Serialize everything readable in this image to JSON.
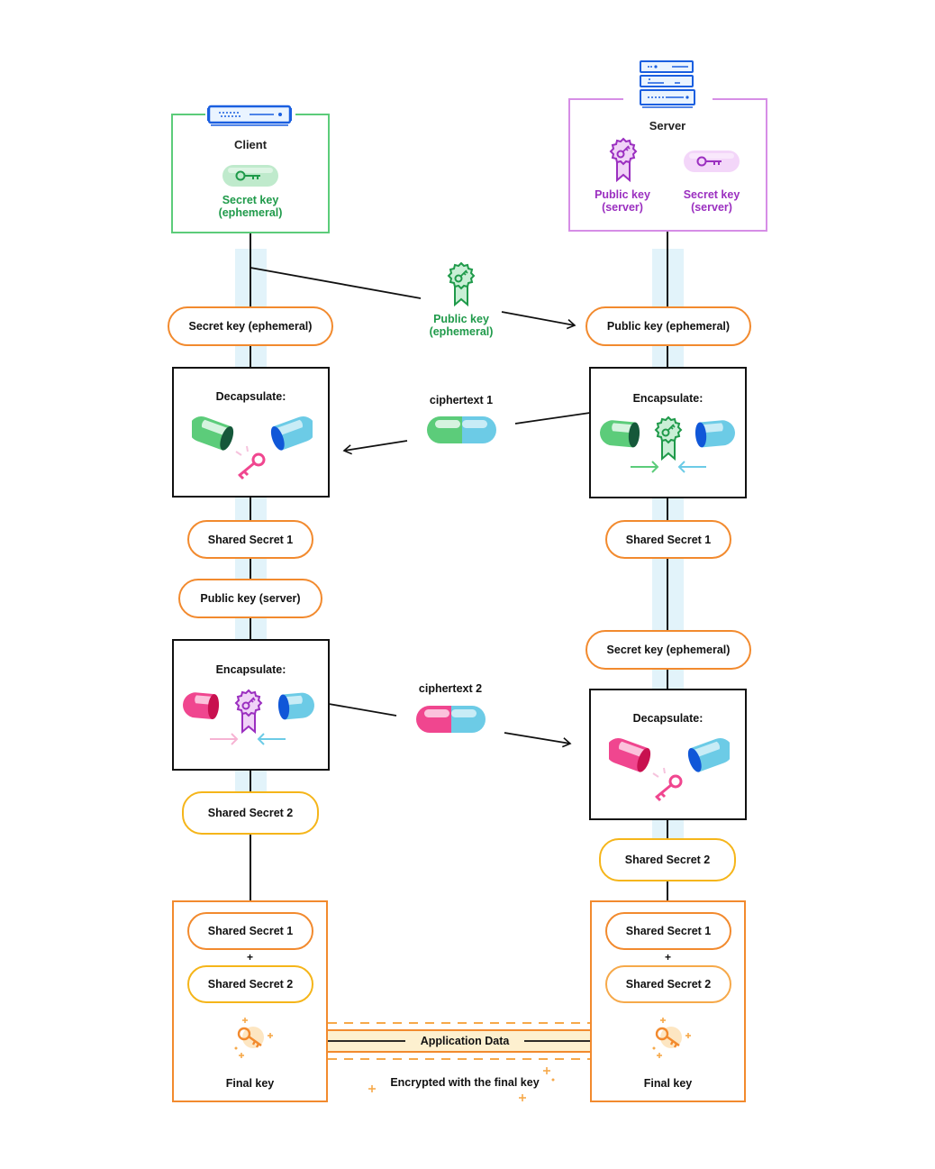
{
  "client": {
    "title": "Client",
    "key_label_line1": "Secret key",
    "key_label_line2": "(ephemeral)",
    "frame_color": "#5ccc7a",
    "icon": "client-device-icon"
  },
  "server": {
    "title": "Server",
    "public_key_line1": "Public key",
    "public_key_line2": "(server)",
    "secret_key_line1": "Secret key",
    "secret_key_line2": "(server)",
    "frame_color": "#d68ee6",
    "icon": "server-rack-icon"
  },
  "transfer": {
    "public_key_line1": "Public key",
    "public_key_line2": "(ephemeral)",
    "ciphertext1": "ciphertext 1",
    "ciphertext2": "ciphertext 2"
  },
  "client_flow": {
    "secret_key_ephemeral": "Secret key (ephemeral)",
    "decapsulate": "Decapsulate:",
    "shared_secret_1": "Shared Secret 1",
    "public_key_server": "Public key (server)",
    "encapsulate": "Encapsulate:",
    "shared_secret_2": "Shared Secret 2"
  },
  "server_flow": {
    "public_key_ephemeral": "Public key (ephemeral)",
    "encapsulate": "Encapsulate:",
    "shared_secret_1": "Shared Secret 1",
    "secret_key_ephemeral": "Secret key (ephemeral)",
    "decapsulate": "Decapsulate:",
    "shared_secret_2": "Shared Secret 2"
  },
  "final": {
    "client": {
      "ss1": "Shared Secret 1",
      "plus": "+",
      "ss2": "Shared Secret 2",
      "label": "Final key"
    },
    "server": {
      "ss1": "Shared Secret 1",
      "plus": "+",
      "ss2": "Shared Secret 2",
      "label": "Final key"
    }
  },
  "application_data": {
    "label": "Application Data",
    "caption": "Encrypted with the final key"
  },
  "colors": {
    "orange": "#f28a2e",
    "yellow": "#f5b51a",
    "green": "#1f9a4a",
    "purple": "#9b2fc0",
    "lane": "#e2f3fa",
    "pink": "#f0468f",
    "blue": "#6ccbe6"
  }
}
